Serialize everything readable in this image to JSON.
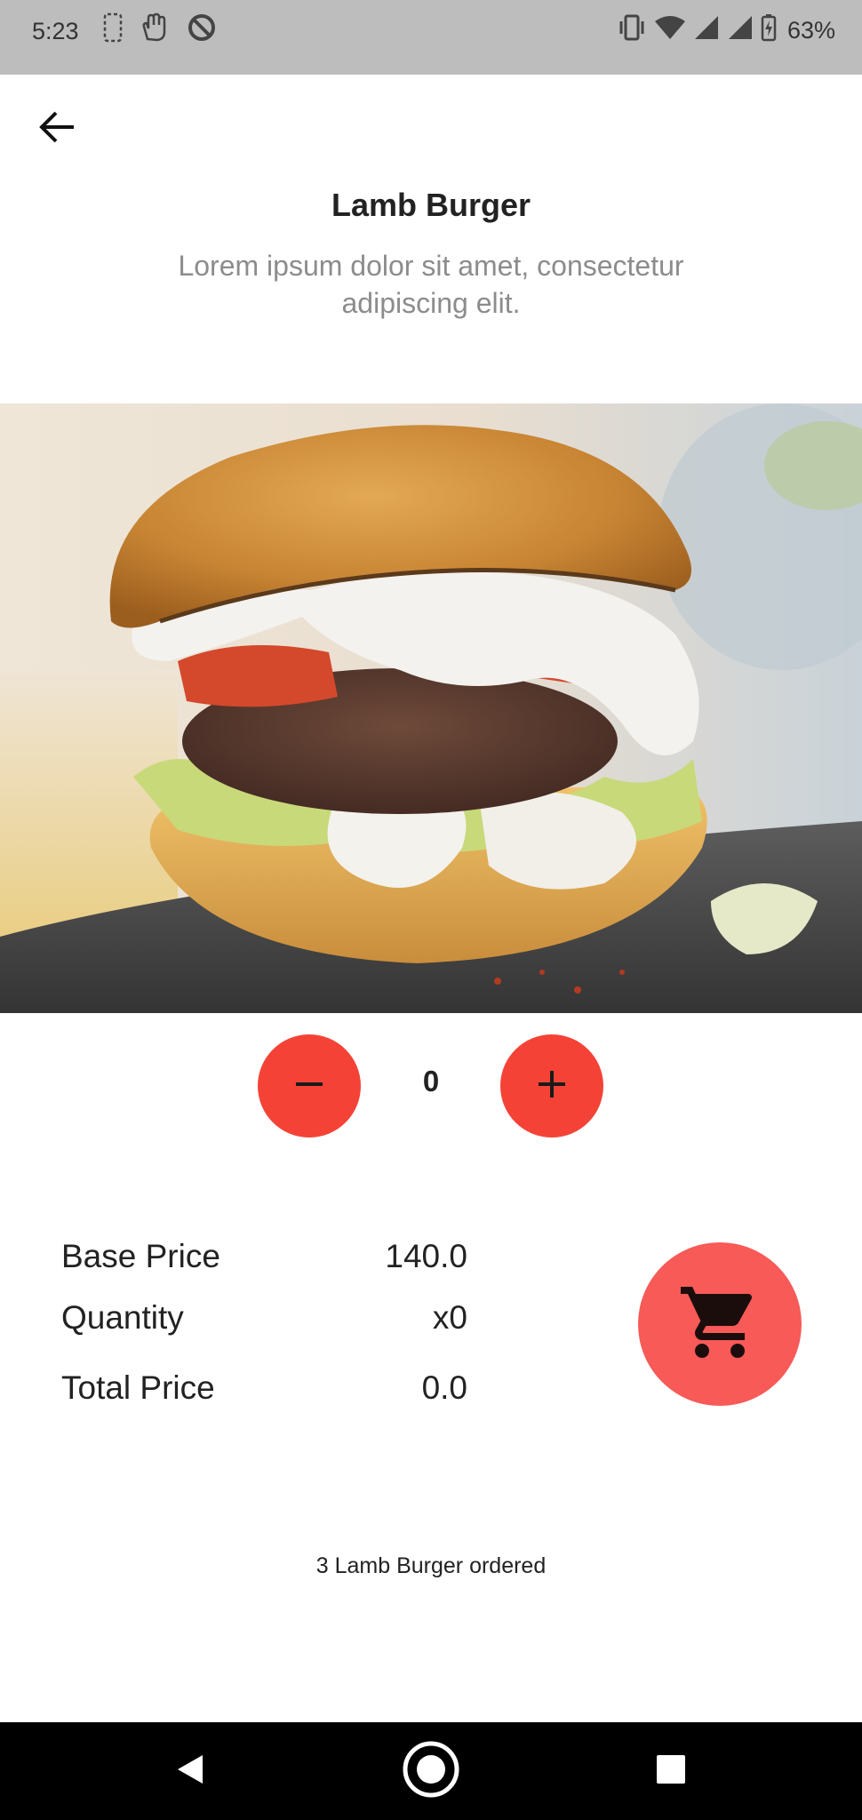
{
  "status_bar": {
    "time": "5:23",
    "battery_percent": "63%",
    "left_icons": [
      "sim-card-icon",
      "hand-gesture-icon",
      "do-not-disturb-icon"
    ],
    "right_icons": [
      "vibrate-icon",
      "wifi-icon",
      "cell-signal-icon",
      "cell-signal-icon",
      "battery-charging-icon"
    ]
  },
  "header": {
    "back_icon": "arrow-left-icon",
    "title": "Lamb Burger",
    "subtitle": "Lorem ipsum dolor sit amet, consectetur adipiscing elit."
  },
  "hero": {
    "image": "burger-photo"
  },
  "stepper": {
    "minus_icon": "minus-icon",
    "plus_icon": "plus-icon",
    "quantity": "0"
  },
  "prices": {
    "base_label": "Base Price",
    "base_value": "140.0",
    "quantity_label": "Quantity",
    "quantity_value": "x0",
    "total_label": "Total Price",
    "total_value": "0.0"
  },
  "cart": {
    "icon": "shopping-cart-icon"
  },
  "order_status": "3 Lamb Burger ordered",
  "nav_bar": {
    "icons": [
      "nav-back-icon",
      "nav-home-icon",
      "nav-recents-icon"
    ]
  },
  "colors": {
    "accent": "#f44336",
    "cart_fab": "#f75a57",
    "status_bar": "#bdbdbd",
    "nav_bar": "#000000",
    "subtitle": "#8c8c8c"
  }
}
